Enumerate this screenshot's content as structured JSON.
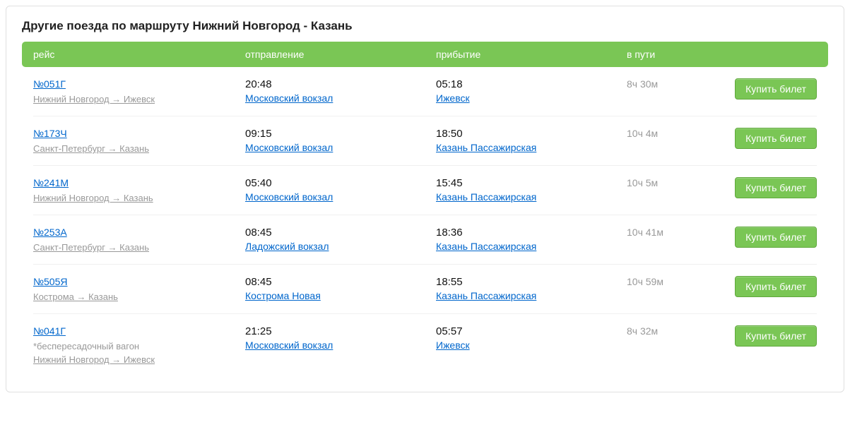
{
  "title": "Другие поезда по маршруту Нижний Новгород - Казань",
  "headers": {
    "route": "рейс",
    "depart": "отправление",
    "arrive": "прибытие",
    "duration": "в пути"
  },
  "buy_label": "Купить билет",
  "trains": [
    {
      "number": "№051Г",
      "note": "",
      "route": "Нижний Новгород → Ижевск",
      "dep_time": "20:48",
      "dep_station": "Московский вокзал",
      "arr_time": "05:18",
      "arr_station": "Ижевск",
      "duration": "8ч 30м"
    },
    {
      "number": "№173Ч",
      "note": "",
      "route": "Санкт-Петербург → Казань",
      "dep_time": "09:15",
      "dep_station": "Московский вокзал",
      "arr_time": "18:50",
      "arr_station": "Казань Пассажирская",
      "duration": "10ч 4м"
    },
    {
      "number": "№241М",
      "note": "",
      "route": "Нижний Новгород → Казань",
      "dep_time": "05:40",
      "dep_station": "Московский вокзал",
      "arr_time": "15:45",
      "arr_station": "Казань Пассажирская",
      "duration": "10ч 5м"
    },
    {
      "number": "№253А",
      "note": "",
      "route": "Санкт-Петербург → Казань",
      "dep_time": "08:45",
      "dep_station": "Ладожский вокзал",
      "arr_time": "18:36",
      "arr_station": "Казань Пассажирская",
      "duration": "10ч 41м"
    },
    {
      "number": "№505Я",
      "note": "",
      "route": "Кострома → Казань",
      "dep_time": "08:45",
      "dep_station": "Кострома Новая",
      "arr_time": "18:55",
      "arr_station": "Казань Пассажирская",
      "duration": "10ч 59м"
    },
    {
      "number": "№041Г",
      "note": "*беспересадочный вагон",
      "route": "Нижний Новгород → Ижевск",
      "dep_time": "21:25",
      "dep_station": "Московский вокзал",
      "arr_time": "05:57",
      "arr_station": "Ижевск",
      "duration": "8ч 32м"
    }
  ]
}
